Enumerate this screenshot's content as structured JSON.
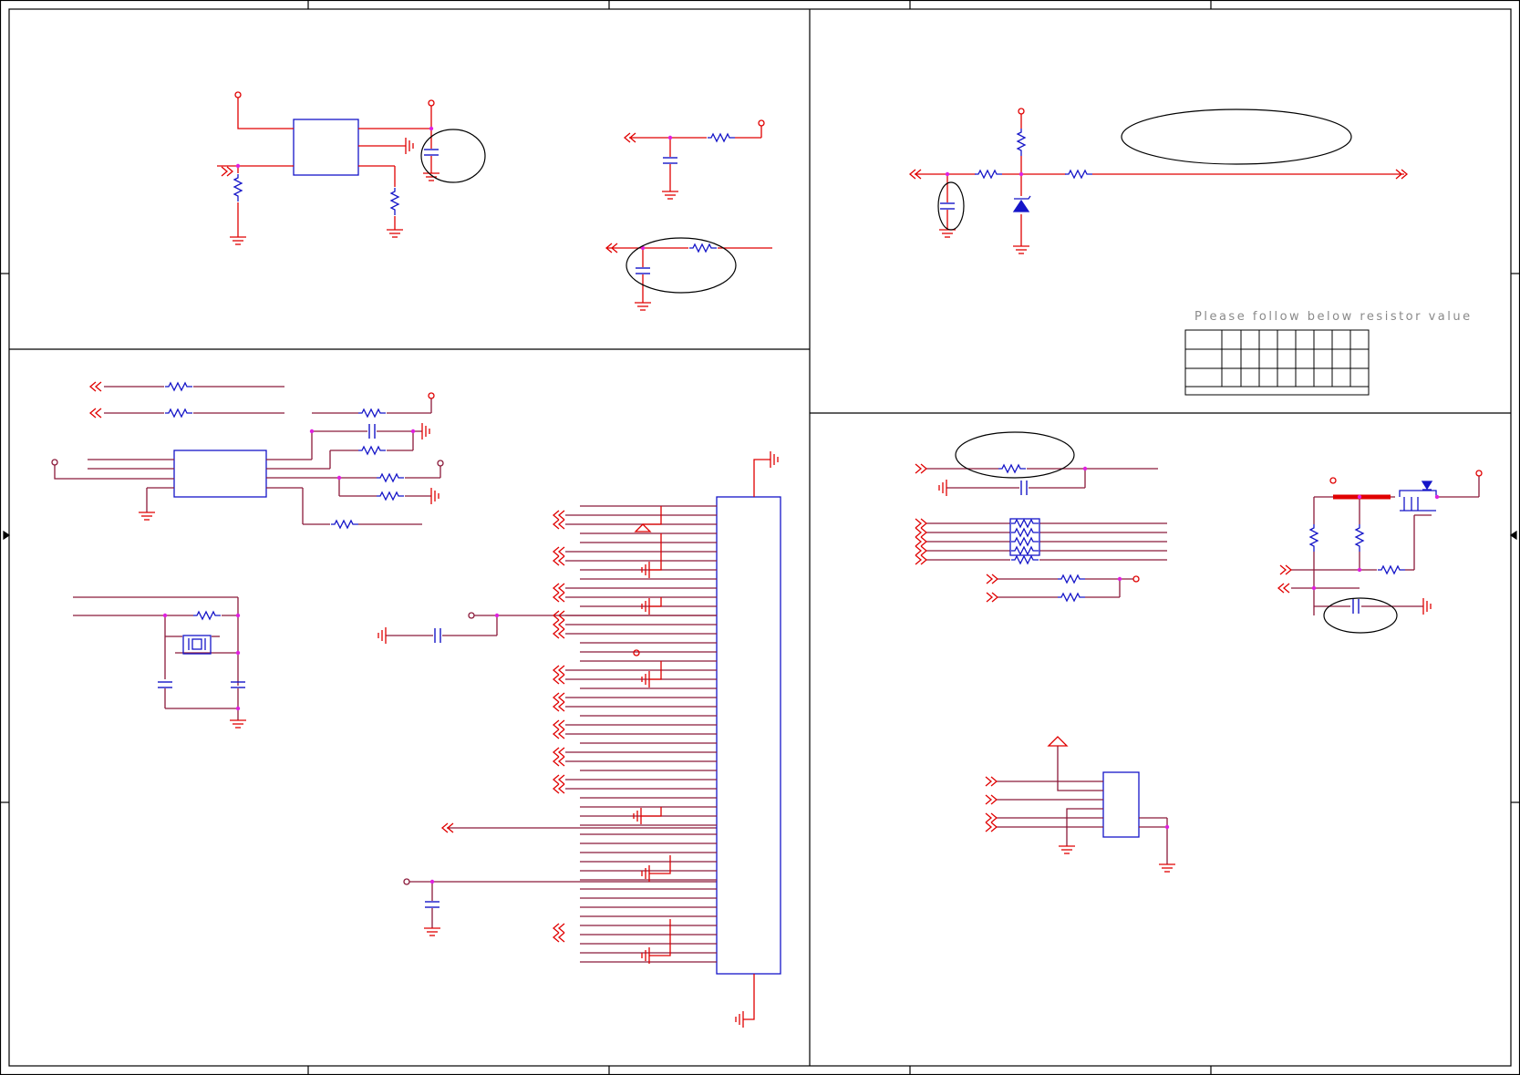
{
  "schematic": {
    "note": "Please follow below resistor value",
    "colors": {
      "wire": "#e00000",
      "bus_wire": "#8b1a3a",
      "component": "#1515c8",
      "border": "#000000",
      "junction": "#e020e0",
      "ellipse": "#000000",
      "note_text": "#8a8a8a"
    },
    "panels": [
      "top-left-regulator-block",
      "top-right-input-network",
      "bottom-left-connector-block",
      "bottom-right-interface-block"
    ],
    "components": {
      "connector": "tall rectangular header",
      "resistor_network": "4-resistor array",
      "crystal": "crystal resonator",
      "zener": "zener diode",
      "mosfet": "p-channel mosfet"
    }
  }
}
